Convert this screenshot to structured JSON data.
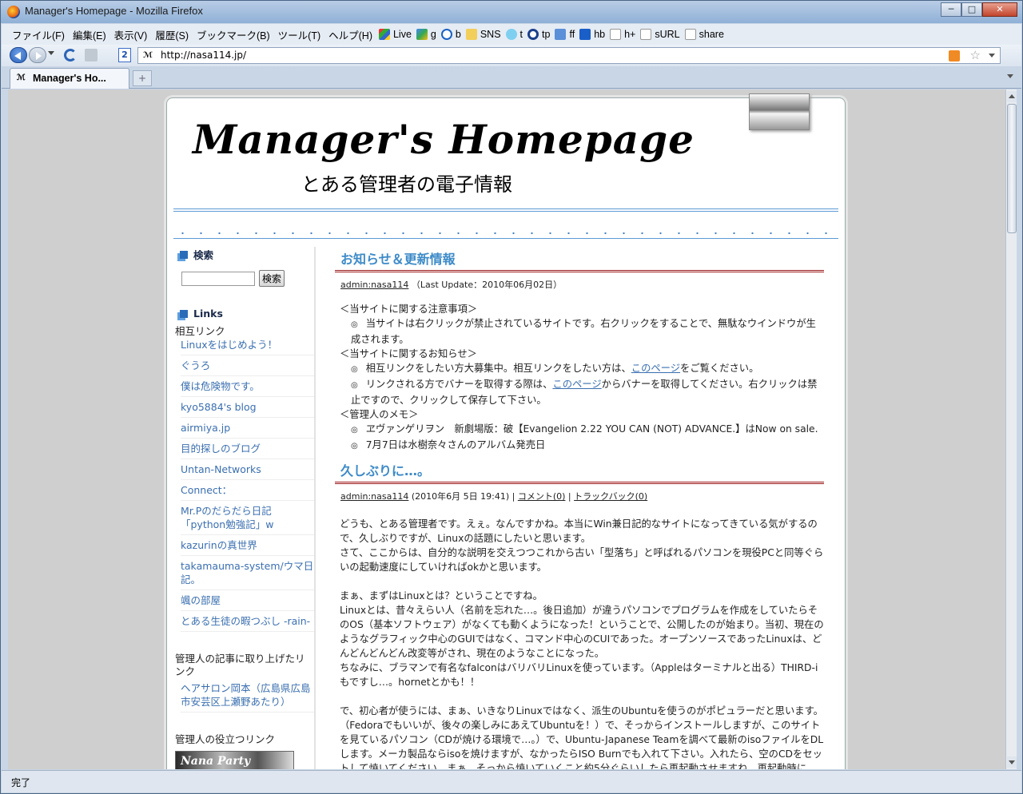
{
  "window": {
    "title": "Manager's Homepage - Mozilla Firefox"
  },
  "menubar": {
    "items": [
      "ファイル(F)",
      "編集(E)",
      "表示(V)",
      "履歴(S)",
      "ブックマーク(B)",
      "ツール(T)",
      "ヘルプ(H)"
    ],
    "bookmarks": [
      "Live",
      "g",
      "b",
      "SNS",
      "t",
      "tp",
      "ff",
      "hb",
      "h+",
      "sURL",
      "share"
    ]
  },
  "navbar": {
    "url": "http://nasa114.jp/"
  },
  "tab": {
    "label": "Manager's Ho...",
    "new_tab": "+"
  },
  "status": {
    "text": "完了"
  },
  "header": {
    "title": "Manager's Homepage",
    "subtitle": "とある管理者の電子情報"
  },
  "sidebar": {
    "search_heading": "検索",
    "search_button": "検索",
    "links_heading": "Links",
    "mutual_label": "相互リンク",
    "mutual_links": [
      "Linuxをはじめよう！",
      "ぐうろ",
      "僕は危険物です。",
      "kyo5884's blog",
      "airmiya.jp",
      "目的探しのブログ",
      "Untan-Networks",
      "Connect：",
      "Mr.Pのだらだら日記「python勉強記」w",
      "kazurinの真世界",
      "takamauma-system/ウマ日記。",
      "颯の部屋",
      "とある生徒の暇つぶし -rain-"
    ],
    "article_label": "管理人の記事に取り上げたリンク",
    "article_links": [
      "ヘアサロン岡本（広島県広島市安芸区上瀬野あたり）"
    ],
    "useful_label": "管理人の役立つリンク",
    "banner_text": "Nana Party"
  },
  "posts": [
    {
      "title": "お知らせ＆更新情報",
      "author": "admin:nasa114",
      "meta": "（Last Update：2010年06月02日）",
      "lines": {
        "h1": "＜当サイトに関する注意事項＞",
        "b1": "当サイトは右クリックが禁止されているサイトです。右クリックをすることで、無駄なウインドウが生成されます。",
        "h2": "＜当サイトに関するお知らせ＞",
        "b2a": "相互リンクをしたい方大募集中。相互リンクをしたい方は、",
        "b2link": "このページ",
        "b2b": "をご覧ください。",
        "b3a": "リンクされる方でバナーを取得する際は、",
        "b3link": "このページ",
        "b3b": "からバナーを取得してください。右クリックは禁止ですので、クリックして保存して下さい。",
        "h3": "＜管理人のメモ＞",
        "b4": "ヱヴァンゲリヲン　新劇場版：破【Evangelion 2.22 YOU CAN (NOT) ADVANCE.】はNow on sale.",
        "b5": "7月7日は水樹奈々さんのアルバム発売日"
      }
    },
    {
      "title": "久しぶりに…。",
      "author": "admin:nasa114",
      "date": "(2010年6月 5日 19:41)",
      "comment": "コメント(0)",
      "trackback": "トラックバック(0)",
      "paras": [
        "どうも、とある管理者です。えぇ。なんですかね。本当にWin兼日記的なサイトになってきている気がするので、久しぶりですが、Linuxの話題にしたいと思います。",
        "さて、ここからは、自分的な説明を交えつつこれから古い「型落ち」と呼ばれるパソコンを現役PCと同等ぐらいの起動速度にしていければokかと思います。",
        "まぁ、まずはLinuxとは？ということですね。",
        "Linuxとは、昔々えらい人（名前を忘れた…。後日追加）が違うパソコンでプログラムを作成をしていたらそのOS（基本ソフトウェア）がなくても動くようになった！ということで、公開したのが始まり。当初、現在のようなグラフィック中心のGUIではなく、コマンド中心のCUIであった。オープンソースであったLinuxは、どんどんどんどん改変等がされ、現在のようなことになった。",
        "ちなみに、ブラマンで有名なfalconはバリバリLinuxを使っています。（Appleはターミナルと出る）THIRD-iもですし…。hornetとかも！！",
        "で、初心者が使うには、まぁ、いきなりLinuxではなく、派生のUbuntuを使うのがポピュラーだと思います。（Fedoraでもいいが、後々の楽しみにあえてUbuntuを！）で、そっからインストールしますが、このサイトを見ているパソコン（CDが焼ける環境で…。）で、Ubuntu-Japanese Teamを調べて最新のisoファイルをDLします。メーカ製品ならisoを焼けますが、なかったらISO Burnでも入れて下さい。入れたら、空のCDをセットして焼いてください。まぁ、そっから焼いていくこと約5分ぐらいしたら再起動させますね。再起動時にBIOS（わからん人は調べてください…）を表示させてCDから起動するように変更します。変更後保存して、起"
      ]
    }
  ]
}
